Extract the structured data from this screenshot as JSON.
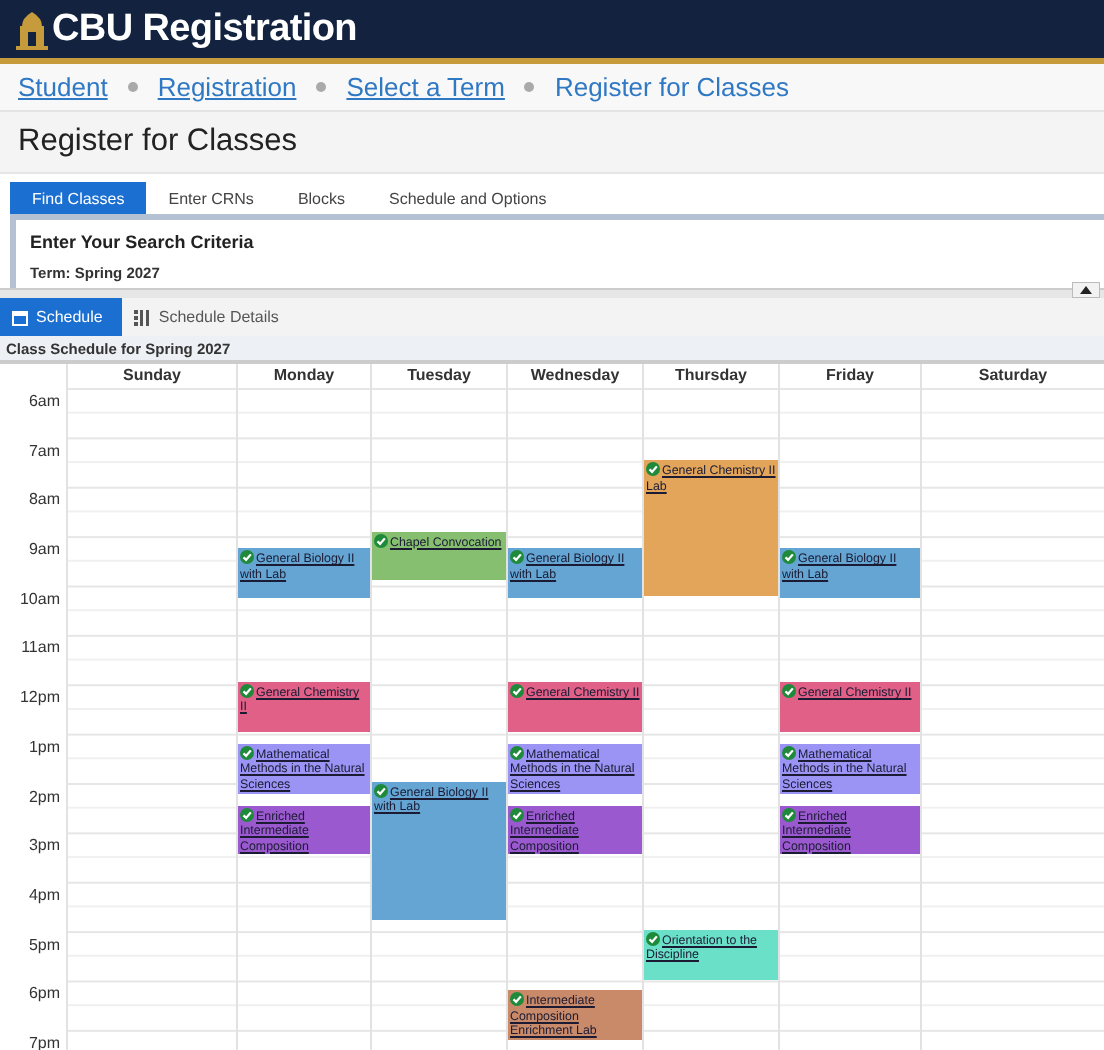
{
  "header": {
    "title": "CBU Registration"
  },
  "breadcrumbs": [
    {
      "label": "Student",
      "link": true
    },
    {
      "label": "Registration",
      "link": true
    },
    {
      "label": "Select a Term",
      "link": true
    },
    {
      "label": "Register for Classes",
      "link": false
    }
  ],
  "page_title": "Register for Classes",
  "tabs": [
    {
      "label": "Find Classes",
      "selected": true
    },
    {
      "label": "Enter CRNs",
      "selected": false
    },
    {
      "label": "Blocks",
      "selected": false
    },
    {
      "label": "Schedule and Options",
      "selected": false
    }
  ],
  "search_panel": {
    "heading": "Enter Your Search Criteria",
    "term": "Term: Spring 2027"
  },
  "schedule_tabs": [
    {
      "label": "Schedule",
      "kind": "calendar",
      "selected": true
    },
    {
      "label": "Schedule Details",
      "kind": "list",
      "selected": false
    }
  ],
  "caption": "Class Schedule for Spring 2027",
  "hours": [
    "6am",
    "7am",
    "8am",
    "9am",
    "10am",
    "11am",
    "12pm",
    "1pm",
    "2pm",
    "3pm",
    "4pm",
    "5pm",
    "6pm",
    "7pm"
  ],
  "days": [
    {
      "name": "Sunday"
    },
    {
      "name": "Monday",
      "events": [
        {
          "title": "General Biology II with Lab",
          "color": "#64a5d3"
        },
        {
          "title": "General Chemistry II",
          "color": "#e06088"
        },
        {
          "title": "Mathematical Methods in the Natural Sciences",
          "color": "#9b94f5"
        },
        {
          "title": "Enriched Intermediate Composition",
          "color": "#9b59cf"
        }
      ]
    },
    {
      "name": "Tuesday",
      "events": [
        {
          "title": "Chapel Convocation",
          "color": "#86bf6f"
        },
        {
          "title": "General Biology II with Lab",
          "color": "#64a5d3"
        }
      ]
    },
    {
      "name": "Wednesday",
      "events": [
        {
          "title": "General Biology II with Lab",
          "color": "#64a5d3"
        },
        {
          "title": "General Chemistry II",
          "color": "#e06088"
        },
        {
          "title": "Mathematical Methods in the Natural Sciences",
          "color": "#9b94f5"
        },
        {
          "title": "Enriched Intermediate Composition",
          "color": "#9b59cf"
        },
        {
          "title": "Intermediate Composition Enrichment Lab",
          "color": "#c98a6a"
        }
      ]
    },
    {
      "name": "Thursday",
      "events": [
        {
          "title": "General Chemistry II Lab",
          "color": "#e2a55a"
        },
        {
          "title": "Orientation to the Discipline",
          "color": "#6ae0c8"
        }
      ]
    },
    {
      "name": "Friday",
      "events": [
        {
          "title": "General Biology II with Lab",
          "color": "#64a5d3"
        },
        {
          "title": "General Chemistry II",
          "color": "#e06088"
        },
        {
          "title": "Mathematical Methods in the Natural Sciences",
          "color": "#9b94f5"
        },
        {
          "title": "Enriched Intermediate Composition",
          "color": "#9b59cf"
        }
      ]
    },
    {
      "name": "Saturday"
    }
  ]
}
